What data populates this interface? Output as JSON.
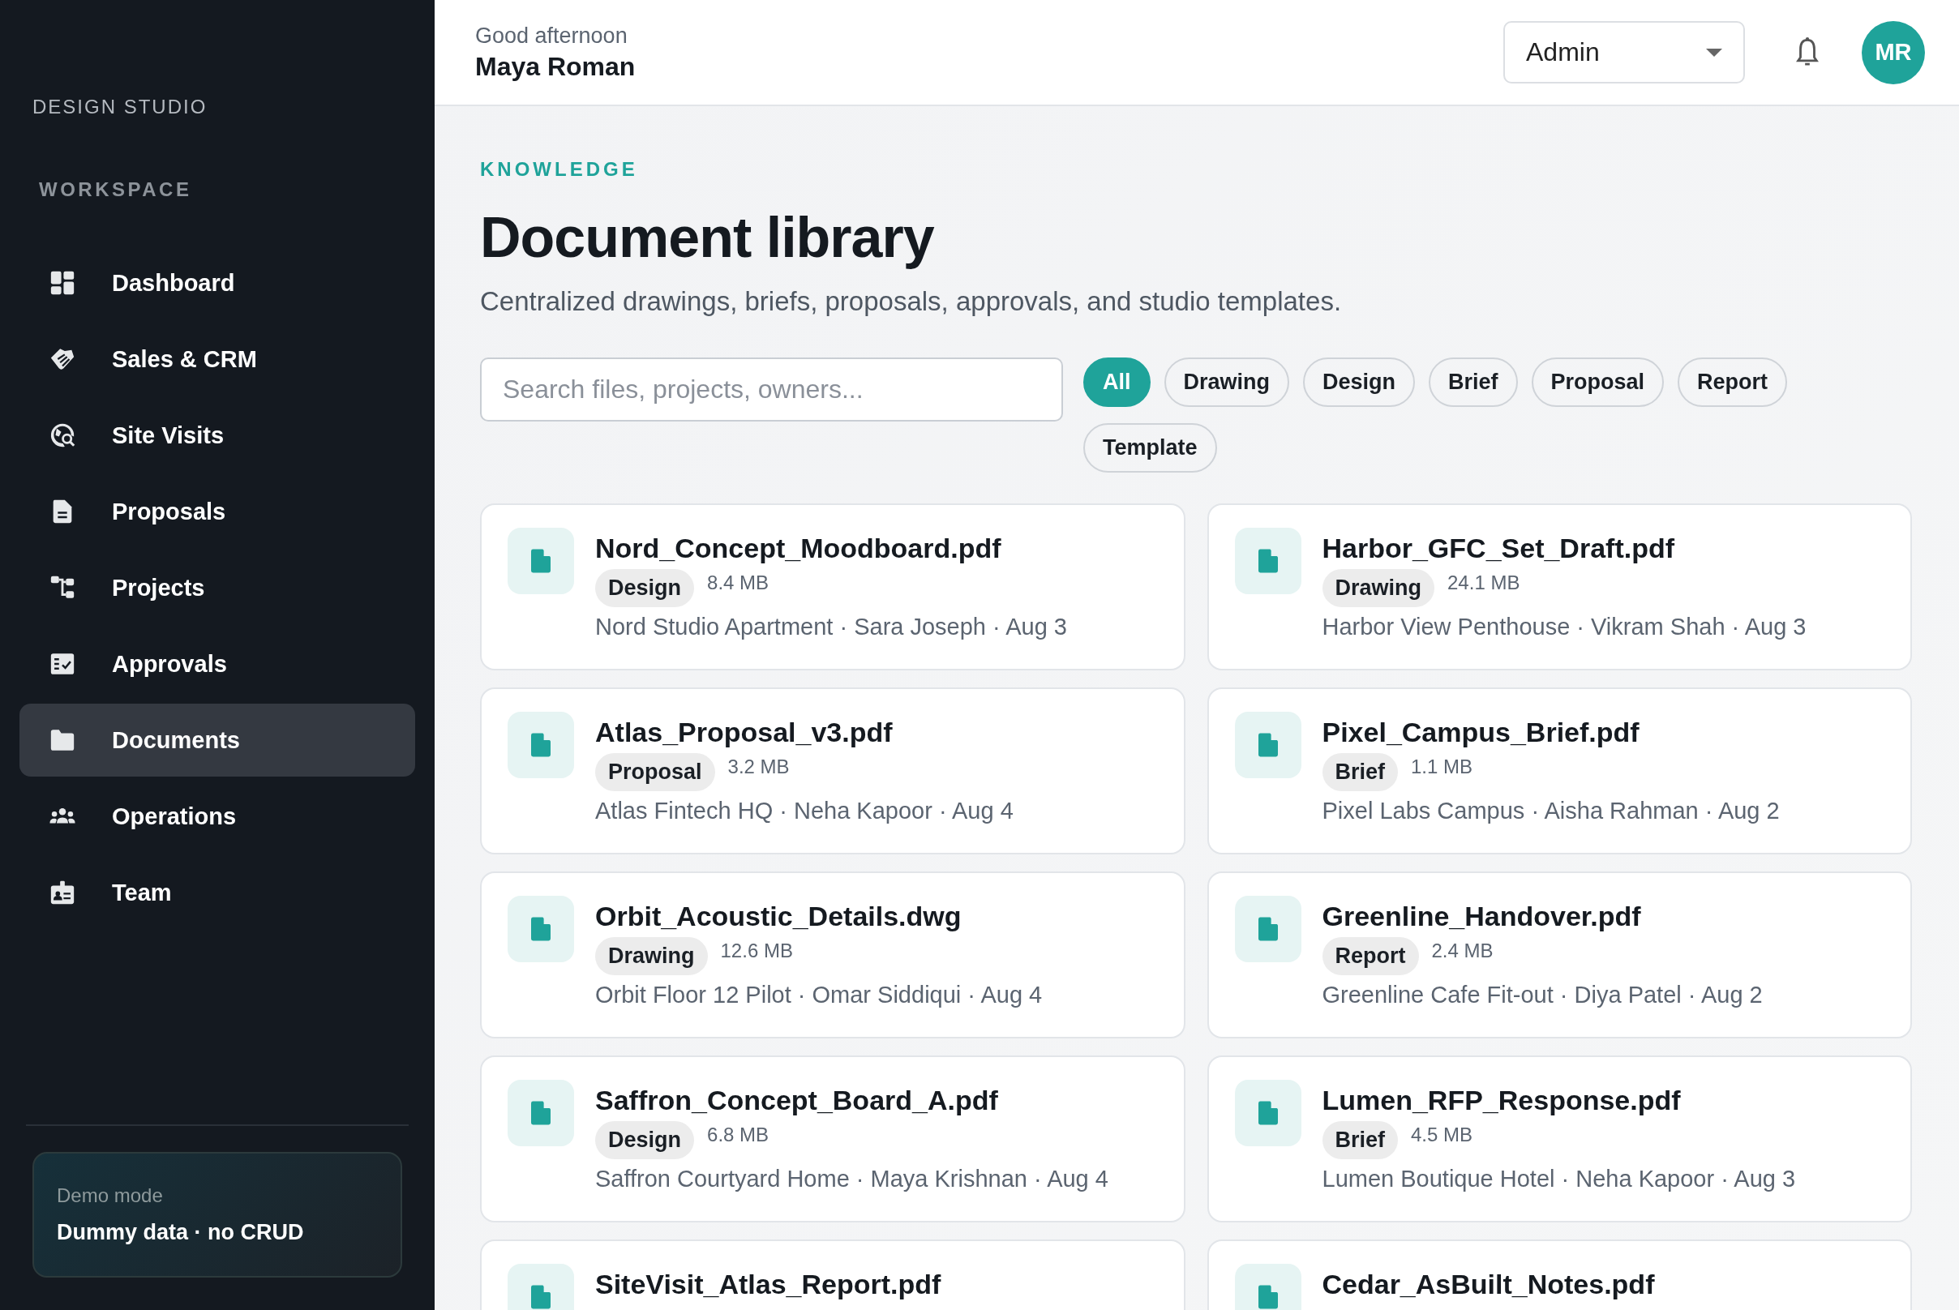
{
  "sidebar": {
    "brand": "DESIGN STUDIO",
    "section": "WORKSPACE",
    "items": [
      {
        "label": "Dashboard",
        "selected": false
      },
      {
        "label": "Sales & CRM",
        "selected": false
      },
      {
        "label": "Site Visits",
        "selected": false
      },
      {
        "label": "Proposals",
        "selected": false
      },
      {
        "label": "Projects",
        "selected": false
      },
      {
        "label": "Approvals",
        "selected": false
      },
      {
        "label": "Documents",
        "selected": true
      },
      {
        "label": "Operations",
        "selected": false
      },
      {
        "label": "Team",
        "selected": false
      }
    ],
    "demo": {
      "label": "Demo mode",
      "text": "Dummy data · no CRUD"
    }
  },
  "header": {
    "greeting": "Good afternoon",
    "user": "Maya Roman",
    "role_select": {
      "value": "Admin"
    },
    "avatar": "MR"
  },
  "page": {
    "eyebrow": "KNOWLEDGE",
    "title": "Document library",
    "subtitle": "Centralized drawings, briefs, proposals, approvals, and studio templates.",
    "search": {
      "placeholder": "Search files, projects, owners..."
    },
    "filters": [
      {
        "label": "All",
        "selected": true
      },
      {
        "label": "Drawing",
        "selected": false
      },
      {
        "label": "Design",
        "selected": false
      },
      {
        "label": "Brief",
        "selected": false
      },
      {
        "label": "Proposal",
        "selected": false
      },
      {
        "label": "Report",
        "selected": false
      },
      {
        "label": "Template",
        "selected": false
      }
    ],
    "documents": [
      {
        "name": "Nord_Concept_Moodboard.pdf",
        "tag": "Design",
        "size": "8.4 MB",
        "meta": "Nord Studio Apartment · Sara Joseph · Aug 3"
      },
      {
        "name": "Harbor_GFC_Set_Draft.pdf",
        "tag": "Drawing",
        "size": "24.1 MB",
        "meta": "Harbor View Penthouse · Vikram Shah · Aug 3"
      },
      {
        "name": "Atlas_Proposal_v3.pdf",
        "tag": "Proposal",
        "size": "3.2 MB",
        "meta": "Atlas Fintech HQ · Neha Kapoor · Aug 4"
      },
      {
        "name": "Pixel_Campus_Brief.pdf",
        "tag": "Brief",
        "size": "1.1 MB",
        "meta": "Pixel Labs Campus · Aisha Rahman · Aug 2"
      },
      {
        "name": "Orbit_Acoustic_Details.dwg",
        "tag": "Drawing",
        "size": "12.6 MB",
        "meta": "Orbit Floor 12 Pilot · Omar Siddiqui · Aug 4"
      },
      {
        "name": "Greenline_Handover.pdf",
        "tag": "Report",
        "size": "2.4 MB",
        "meta": "Greenline Cafe Fit-out · Diya Patel · Aug 2"
      },
      {
        "name": "Saffron_Concept_Board_A.pdf",
        "tag": "Design",
        "size": "6.8 MB",
        "meta": "Saffron Courtyard Home · Maya Krishnan · Aug 4"
      },
      {
        "name": "Lumen_RFP_Response.pdf",
        "tag": "Brief",
        "size": "4.5 MB",
        "meta": "Lumen Boutique Hotel · Neha Kapoor · Aug 3"
      },
      {
        "name": "SiteVisit_Atlas_Report.pdf"
      },
      {
        "name": "Cedar_AsBuilt_Notes.pdf"
      }
    ]
  }
}
